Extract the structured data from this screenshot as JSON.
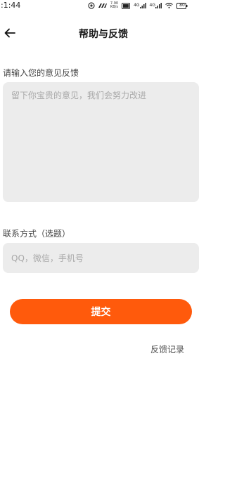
{
  "status_bar": {
    "time": ":1:44",
    "net_speed_value": "7.90",
    "net_speed_unit": "KB/s",
    "signal_1": "4G",
    "signal_2": "4G",
    "battery": "80"
  },
  "header": {
    "title": "帮助与反馈"
  },
  "feedback": {
    "label": "请输入您的意见反馈",
    "placeholder": "留下你宝贵的意见，我们会努力改进"
  },
  "contact": {
    "label": "联系方式（选题）",
    "placeholder": "QQ，微信，手机号"
  },
  "actions": {
    "submit_label": "提交",
    "history_label": "反馈记录"
  },
  "colors": {
    "accent": "#ff5a0c",
    "input_bg": "#ececec"
  }
}
